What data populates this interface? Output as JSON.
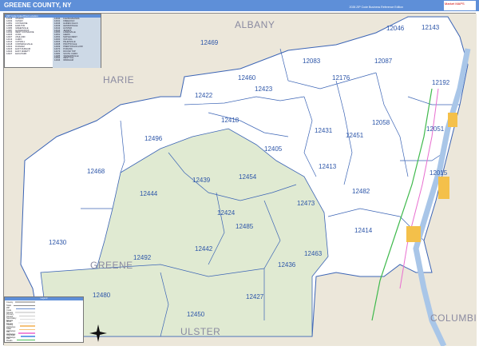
{
  "header": {
    "title": "GREENE COUNTY, NY",
    "edition": "2026 ZIP Code Business Reference Edition",
    "logo_text": "Market MAPS"
  },
  "zip_table": {
    "title": "ZIP Code Index/Post Location",
    "left": [
      [
        "12015",
        "ATHENS"
      ],
      [
        "12042",
        "CLIMAX"
      ],
      [
        "12051",
        "COXSACKIE"
      ],
      [
        "12058",
        "EARLTON"
      ],
      [
        "12083",
        "GREENVILLE"
      ],
      [
        "12087",
        "HANNACROIX"
      ],
      [
        "12192",
        "WEST COXSACKIE"
      ],
      [
        "12405",
        "ACRA"
      ],
      [
        "12407",
        "ASHLAND"
      ],
      [
        "12413",
        "CAIRO"
      ],
      [
        "12414",
        "CATSKILL"
      ],
      [
        "12418",
        "CORNWALLVILLE"
      ],
      [
        "12422",
        "DURHAM"
      ],
      [
        "12423",
        "EAST DURHAM"
      ],
      [
        "12424",
        "EAST JEWETT"
      ],
      [
        "12427",
        "ELKA PARK"
      ]
    ],
    "right": [
      [
        "12430",
        "FLEISCHMANNS"
      ],
      [
        "12431",
        "FREEHOLD"
      ],
      [
        "12436",
        "HAINES FALLS"
      ],
      [
        "12439",
        "HENSONVILLE"
      ],
      [
        "12442",
        "HUNTER"
      ],
      [
        "12444",
        "JEWETT"
      ],
      [
        "12450",
        "LANESVILLE"
      ],
      [
        "12451",
        "LEEDS"
      ],
      [
        "12454",
        "MAPLECREST"
      ],
      [
        "12460",
        "OAK HILL"
      ],
      [
        "12463",
        "PALENVILLE"
      ],
      [
        "12468",
        "PRATTSVILLE"
      ],
      [
        "12469",
        "PRESTON HOLLOW"
      ],
      [
        "12470",
        "PURLING"
      ],
      [
        "12473",
        "ROUND TOP"
      ],
      [
        "12482",
        "SOUTH CAIRO"
      ],
      [
        "12485",
        "TANNERSVILLE"
      ],
      [
        "12492",
        "WEST KILL"
      ],
      [
        "12496",
        "WINDHAM"
      ]
    ]
  },
  "places": {
    "albany": "ALBANY",
    "schoharie": "HARIE",
    "greene": "GREENE",
    "ulster": "ULSTER",
    "columbia": "COLUMBIA"
  },
  "zips": [
    "12469",
    "12046",
    "12143",
    "12460",
    "12423",
    "12083",
    "12087",
    "12176",
    "12192",
    "12422",
    "12418",
    "12058",
    "12051",
    "12431",
    "12451",
    "12496",
    "12405",
    "12413",
    "12015",
    "12468",
    "12454",
    "12439",
    "12444",
    "12482",
    "12473",
    "12424",
    "12485",
    "12414",
    "12430",
    "12442",
    "12463",
    "12492",
    "12436",
    "12480",
    "12427",
    "12450"
  ],
  "legend": {
    "title": "Legend",
    "items": [
      "County",
      "State",
      "ZIP Code",
      "Streets",
      "Primary Streets",
      "Secondary Streets",
      "Minor Streets",
      "County Highways",
      "State Highways",
      "US Highways",
      "Interstate Highways",
      "Rail Roads"
    ]
  },
  "colors": {
    "header": "#5e8fd8",
    "outside": "#ece7da",
    "park": "#e0ead2",
    "water": "#a9c6e8",
    "zip_line": "#3b64b5"
  }
}
